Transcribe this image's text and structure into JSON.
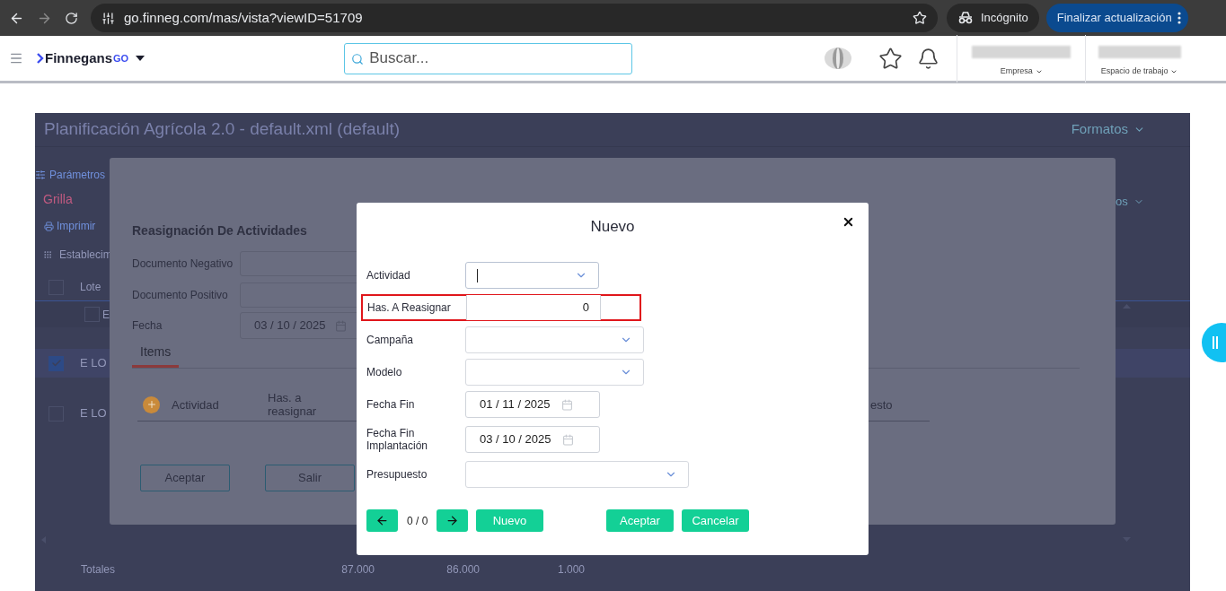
{
  "browser": {
    "url": "go.finneg.com/mas/vista?viewID=51709",
    "profile": "Incógnito",
    "update_button": "Finalizar actualización"
  },
  "app_header": {
    "logo": "Finnegans",
    "logo_suffix": "GO",
    "search_placeholder": "Buscar...",
    "selectors": [
      "Empresa",
      "Espacio de trabajo"
    ]
  },
  "page": {
    "title": "Planificación Agrícola 2.0 - default.xml (default)",
    "formats": "Formatos",
    "params": "Parámetros",
    "grid": "Grilla",
    "print": "Imprimir",
    "group_label": "Establecim",
    "header": {
      "label": "Lote",
      "checked": false
    },
    "rows": [
      {
        "kind": "group",
        "label": "E",
        "checked": false
      },
      {
        "kind": "row",
        "label": "E LO",
        "checked": true
      },
      {
        "kind": "row",
        "label": "E LO",
        "checked": false
      }
    ],
    "side_dropdown": "os",
    "totals": {
      "label": "Totales",
      "values": [
        "87.000",
        "86.000",
        "1.000"
      ]
    }
  },
  "reassign_dialog": {
    "title": "Reasignación De Actividades",
    "fields": [
      {
        "label": "Documento Negativo",
        "kind": "text"
      },
      {
        "label": "Documento Positivo",
        "kind": "text"
      },
      {
        "label": "Fecha",
        "kind": "date",
        "value": "03 / 10 / 2025"
      }
    ],
    "tabs": [
      {
        "label": "Items",
        "selected": true
      }
    ],
    "columns": [
      "Actividad",
      "Has. a reasignar",
      "esto"
    ],
    "buttons": [
      "Aceptar",
      "Salir"
    ]
  },
  "dialog": {
    "title": "Nuevo",
    "fields": [
      {
        "label": "Actividad",
        "kind": "select",
        "focused": true
      },
      {
        "label": "Has. A Reasignar",
        "kind": "number",
        "value": "0",
        "highlighted": true
      },
      {
        "label": "Campaña",
        "kind": "select",
        "focused": false
      },
      {
        "label": "Modelo",
        "kind": "select",
        "focused": false
      },
      {
        "label": "Fecha Fin",
        "kind": "date",
        "value": "01 / 11 / 2025"
      },
      {
        "label": "Fecha Fin Implantación",
        "kind": "date",
        "value": "03 / 10 / 2025"
      },
      {
        "label": "Presupuesto",
        "kind": "select",
        "focused": false
      }
    ],
    "counter": "0 / 0",
    "new_button": "Nuevo",
    "buttons": [
      "Aceptar",
      "Cancelar"
    ]
  }
}
